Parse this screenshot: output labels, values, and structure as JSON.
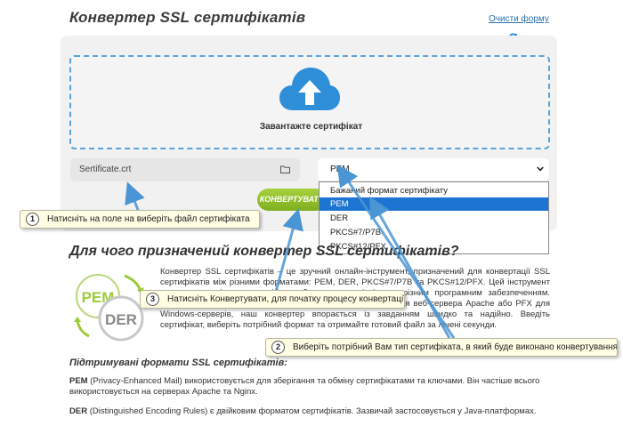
{
  "page": {
    "title": "Конвертер SSL сертифікатів",
    "clear_form": "Очисти форму"
  },
  "upload": {
    "label": "Завантажте сертифікат",
    "file_value": "Sertificate.crt"
  },
  "format_select": {
    "selected": "PEM",
    "options": [
      {
        "label": "Бажаний формат сертифікату",
        "selected": false
      },
      {
        "label": "PEM",
        "selected": true
      },
      {
        "label": "DER",
        "selected": false
      },
      {
        "label": "PKCS#7/P7B",
        "selected": false
      },
      {
        "label": "PKCS#12/PFX",
        "selected": false
      }
    ]
  },
  "convert_button": "КОНВЕРТУВАТИ",
  "about": {
    "heading": "Для чого призначений конвертер SSL сертифікатів?",
    "paragraph": "Конвертер SSL сертифікатів – це зручний онлайн-інструмент, призначений для конвертації SSL сертифікатів між різними форматами: PEM, DER, PKCS#7/P7B та PKCS#12/PFX. Цей інструмент стане в нагоді, коли потрібно забезпечити сумісність з різним програмним забезпеченням. Наприклад, якщо у вас є вам сертифікат у форматі PEM для веб-сервера Apache або PFX для Windows-серверів, наш конвертер впорається із завданням швидко та надійно. Введіть сертифікат, виберіть потрібний формат та отримайте готовий файл за лічені секунди.",
    "logo_text_1": "PEM",
    "logo_text_2": "DER"
  },
  "formats": {
    "heading": "Підтримувані формати SSL сертифікатів:",
    "pem_name": "PEM",
    "pem_desc": " (Privacy-Enhanced Mail) використовується для зберігання та обміну сертифікатами та ключами. Він частіше всього використовується на серверах Apache та Nginx.",
    "der_name": "DER",
    "der_desc": " (Distinguished Encoding Rules) є двійковим форматом сертифікатів. Зазвичай застосовується у Java-платформах."
  },
  "callouts": [
    {
      "num": "1",
      "text": "Натисніть на поле на виберіть файл сертифіката"
    },
    {
      "num": "2",
      "text": "Виберіть потрібний Вам тип сертифіката, в який буде виконано конвертування"
    },
    {
      "num": "3",
      "text": "Натисніть Конвертувати, для початку процесу конвертації"
    }
  ],
  "colors": {
    "accent_blue": "#1e74d2",
    "dropzone_border": "#5aa3d6",
    "button_green": "#8fc02a",
    "callout_bg": "#fffde3"
  }
}
